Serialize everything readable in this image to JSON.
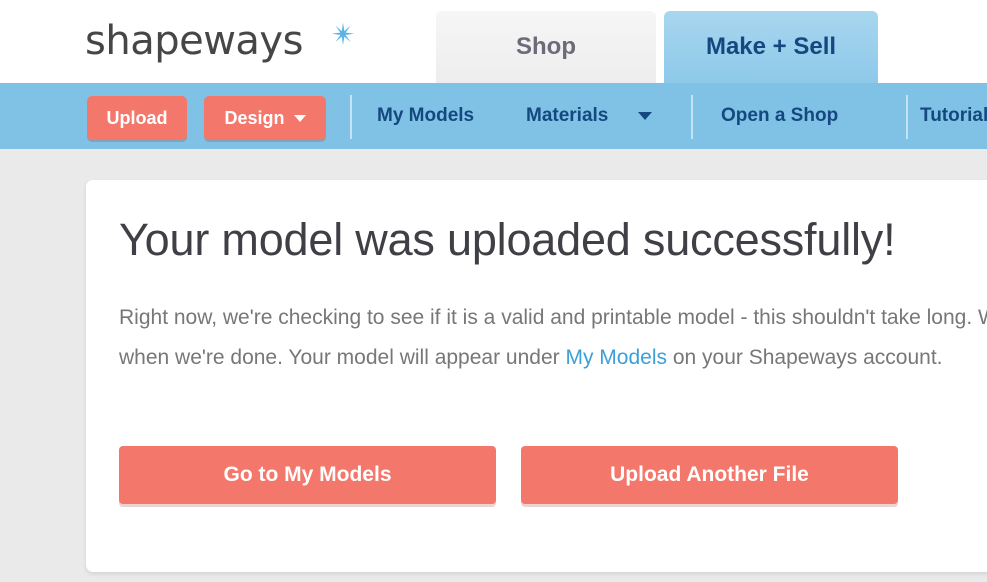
{
  "brand": {
    "name": "shapeways",
    "star_icon": "star-icon",
    "logo_color": "#464646",
    "star_color": "#5cb3e4"
  },
  "top_tabs": [
    {
      "label": "Shop",
      "active": false
    },
    {
      "label": "Make + Sell",
      "active": true
    }
  ],
  "navbar": {
    "background_color": "#7fc2e6",
    "buttons": [
      {
        "label": "Upload",
        "has_caret": false
      },
      {
        "label": "Design",
        "has_caret": true
      }
    ],
    "links": [
      {
        "label": "My Models",
        "has_caret": false
      },
      {
        "label": "Materials",
        "has_caret": true
      },
      {
        "label": "Open a Shop",
        "has_caret": false
      },
      {
        "label": "Tutorials",
        "has_caret": false
      }
    ]
  },
  "card": {
    "heading": "Your model was uploaded successfully!",
    "body_line_1": "Right now, we're checking to see if it is a valid and printable model - this shouldn't take long. We'll email you",
    "body_line_2_before": "when we're done. Your model will appear under ",
    "body_line_2_link": "My Models",
    "body_line_2_after": " on your Shapeways account.",
    "actions": [
      {
        "label": "Go to My Models"
      },
      {
        "label": "Upload Another File"
      }
    ]
  },
  "colors": {
    "accent_salmon": "#f4776b",
    "nav_blue": "#7fc2e6",
    "link_blue": "#3ba0d8",
    "page_background": "#eaeaea",
    "navy_text": "#15487f"
  }
}
